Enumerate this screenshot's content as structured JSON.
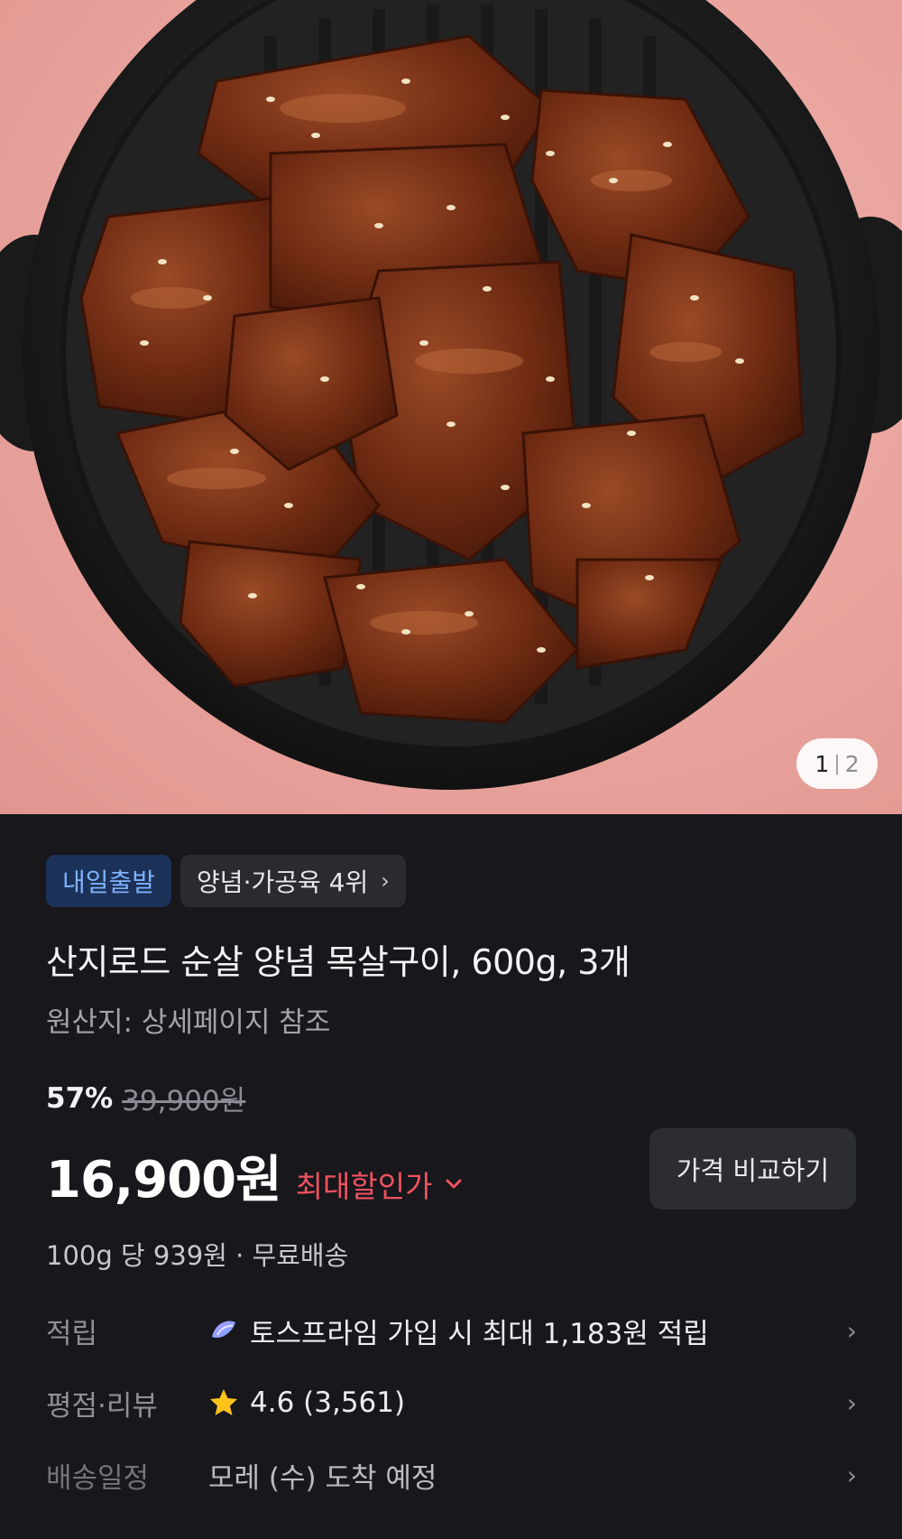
{
  "image": {
    "description_icon": "food-photo",
    "counter_current": "1",
    "counter_separator": "|",
    "counter_total": "2"
  },
  "badges": {
    "delivery": "내일출발",
    "ranking": "양념·가공육 4위"
  },
  "product": {
    "title": "산지로드 순살 양념 목살구이, 600g, 3개",
    "origin": "원산지: 상세페이지 참조"
  },
  "pricing": {
    "discount_percent": "57%",
    "original_price": "39,900원",
    "price": "16,900원",
    "max_discount_label": "최대할인가",
    "compare_button": "가격 비교하기",
    "unit_price": "100g 당 939원 · 무료배송"
  },
  "info_rows": {
    "points": {
      "label": "적립",
      "value": "토스프라임 가입 시 최대 1,183원 적립"
    },
    "review": {
      "label": "평점·리뷰",
      "value": "4.6 (3,561)"
    },
    "shipping": {
      "label": "배송일정",
      "value": "모레 (수) 도착 예정"
    }
  },
  "colors": {
    "background": "#17171c",
    "accent_red": "#f0525f",
    "badge_blue_bg": "#1c3157",
    "badge_blue_text": "#7fb2ff",
    "star": "#ffc21a"
  }
}
